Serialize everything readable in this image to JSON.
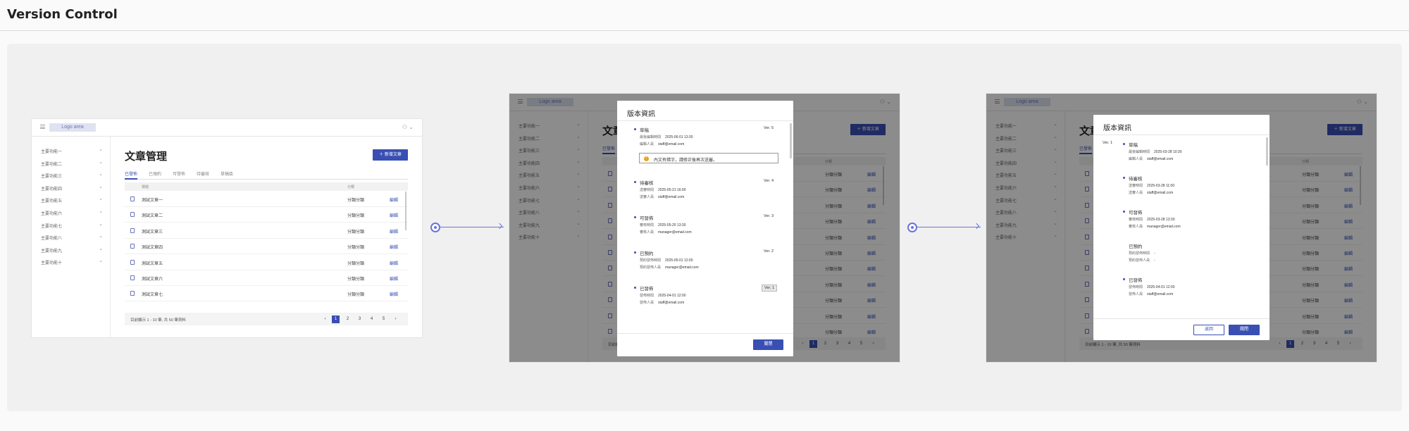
{
  "page": {
    "title": "Version Control"
  },
  "app": {
    "logo": "Logo area",
    "sidebar": [
      "主要功能一",
      "主要功能二",
      "主要功能三",
      "主要功能四",
      "主要功能五",
      "主要功能六",
      "主要功能七",
      "主要功能八",
      "主要功能九",
      "主要功能十"
    ],
    "title": "文章管理",
    "new_button": "新增文章",
    "tabs": [
      "已發佈",
      "已預約",
      "可發佈",
      "待審核",
      "草稿區"
    ],
    "table": {
      "headers": [
        "標題",
        "分類"
      ],
      "rows": [
        {
          "title": "測試文章一",
          "category": "分類分類",
          "action": "編輯"
        },
        {
          "title": "測試文章二",
          "category": "分類分類",
          "action": "編輯"
        },
        {
          "title": "測試文章三",
          "category": "分類分類",
          "action": "編輯"
        },
        {
          "title": "測試文章四",
          "category": "分類分類",
          "action": "編輯"
        },
        {
          "title": "測試文章五",
          "category": "分類分類",
          "action": "編輯"
        },
        {
          "title": "測試文章六",
          "category": "分類分類",
          "action": "編輯"
        },
        {
          "title": "測試文章七",
          "category": "分類分類",
          "action": "編輯"
        }
      ]
    },
    "pagination": {
      "info": "目前顯示 1 - 10 筆, 共 50 筆資料",
      "pages": [
        "1",
        "2",
        "3",
        "4",
        "5"
      ],
      "current": "1",
      "prev": "‹",
      "next": "›"
    }
  },
  "modal1": {
    "title": "版本資訊",
    "close_button": "關閉",
    "versions": [
      {
        "label": "草稿",
        "r1_label": "最後編輯時間",
        "r1_value": "2025-06-01 13:30",
        "r2_label": "編輯人員",
        "r2_value": "staff@email.com",
        "version": "Ver. 5"
      },
      {
        "label": "待審核",
        "r1_label": "送審時間",
        "r1_value": "2025-05-21 16:00",
        "r2_label": "送審人員",
        "r2_value": "staff@email.com",
        "version": "Ver. 4"
      },
      {
        "label": "可發佈",
        "r1_label": "審核時間",
        "r1_value": "2025-05-20 13:30",
        "r2_label": "審核人員",
        "r2_value": "manager@email.com",
        "version": "Ver. 3"
      },
      {
        "label": "已預約",
        "r1_label": "預約發佈時間",
        "r1_value": "2025-05-01 12:00",
        "r2_label": "預約發佈人員",
        "r2_value": "manager@email.com",
        "version": "Ver. 2"
      },
      {
        "label": "已發佈",
        "r1_label": "發佈時間",
        "r1_value": "2025-04-01 12:00",
        "r2_label": "發佈人員",
        "r2_value": "staff@email.com",
        "version": "Ver. 1"
      }
    ],
    "alert": "內文有錯字，請修正後再次送審。"
  },
  "modal2": {
    "title": "版本資訊",
    "current_version": "Ver. 1",
    "back_button": "返回",
    "close_button": "關閉",
    "versions": [
      {
        "label": "草稿",
        "r1_label": "最後編輯時間",
        "r1_value": "2025-03-28 10:30",
        "r2_label": "編輯人員",
        "r2_value": "staff@email.com"
      },
      {
        "label": "待審核",
        "r1_label": "送審時間",
        "r1_value": "2025-03-28 11:00",
        "r2_label": "送審人員",
        "r2_value": "staff@email.com"
      },
      {
        "label": "可發佈",
        "r1_label": "審核時間",
        "r1_value": "2025-03-28 13:30",
        "r2_label": "審核人員",
        "r2_value": "manager@email.com"
      },
      {
        "label": "已預約",
        "r1_label": "預約發佈時間",
        "r1_value": "-",
        "r2_label": "預約發佈人員",
        "r2_value": "-"
      },
      {
        "label": "已發佈",
        "r1_label": "發佈時間",
        "r1_value": "2025-04-01 12:00",
        "r2_label": "發佈人員",
        "r2_value": "staff@email.com"
      }
    ]
  },
  "colors": {
    "accent": "#3a4fb3",
    "connector": "#6b74d8",
    "warning": "#e8a418"
  }
}
